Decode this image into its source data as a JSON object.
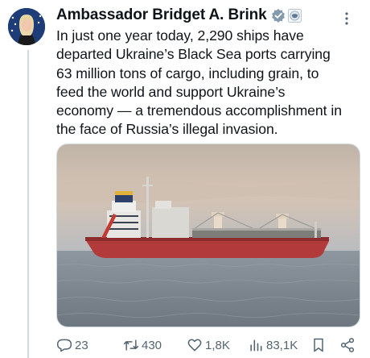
{
  "tweet": {
    "author": "Ambassador Bridget A. Brink",
    "text": "In just one year today, 2,290 ships have\ndeparted Ukraine’s Black Sea ports carrying\n63 million tons of cargo, including grain, to\nfeed the world and support Ukraine’s\neconomy — a tremendous accomplishment in\nthe face of Russia’s illegal invasion."
  },
  "actions": {
    "replies": "23",
    "reposts": "430",
    "likes": "1,8K",
    "views": "83,1K"
  },
  "icons": {
    "verified": "verified-badge-icon",
    "gov": "government-badge-icon",
    "more": "more-options-icon",
    "reply": "reply-icon",
    "repost": "repost-icon",
    "like": "heart-icon",
    "views": "views-icon",
    "bookmark": "bookmark-icon",
    "share": "share-icon"
  },
  "colors": {
    "verified": "#829aab",
    "icon": "#536471",
    "hull": "#b23a3a"
  }
}
